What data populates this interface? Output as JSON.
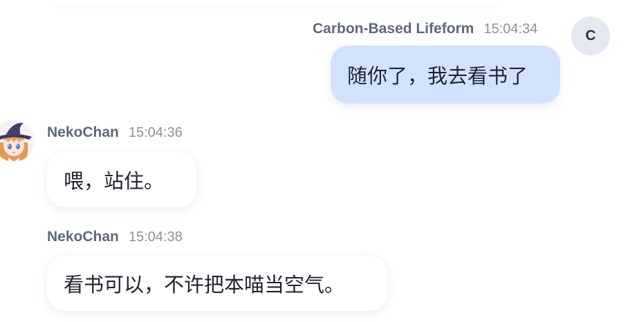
{
  "messages": [
    {
      "sender": "Carbon-Based Lifeform",
      "time": "15:04:34",
      "avatar_letter": "C",
      "text": "随你了，我去看书了"
    },
    {
      "sender": "NekoChan",
      "time": "15:04:36",
      "text": "喂，站住。"
    },
    {
      "sender": "NekoChan",
      "time": "15:04:38",
      "text": "看书可以，不许把本喵当空气。"
    }
  ],
  "colors": {
    "self_bubble": "#d2e2fd",
    "other_bubble": "#ffffff",
    "name_text": "#5f6878",
    "time_text": "#8a919e"
  },
  "icons": {
    "neko_avatar": "anime-girl-avatar-icon"
  }
}
